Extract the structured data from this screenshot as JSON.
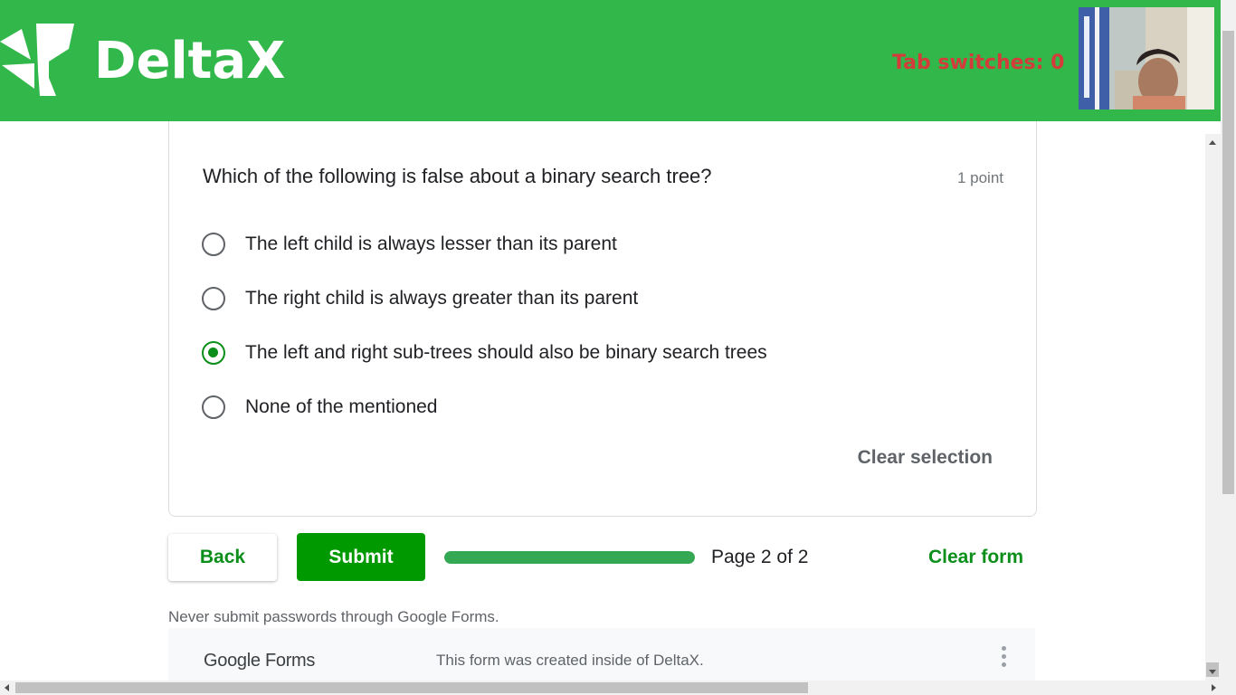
{
  "header": {
    "brand": "DeltaX",
    "tab_switches": "Tab switches: 0"
  },
  "question": {
    "text": "Which of the following is false about a binary search tree?",
    "points": "1 point",
    "options": [
      {
        "label": "The left child is always lesser than its parent",
        "selected": false
      },
      {
        "label": "The right child is always greater than its parent",
        "selected": false
      },
      {
        "label": "The left and right sub-trees should also be binary search trees",
        "selected": true
      },
      {
        "label": "None of the mentioned",
        "selected": false
      }
    ],
    "clear_selection": "Clear selection"
  },
  "navigation": {
    "back_label": "Back",
    "submit_label": "Submit",
    "progress_percent": 100,
    "page_indicator": "Page 2 of 2",
    "clear_form_label": "Clear form"
  },
  "footer": {
    "disclaimer": "Never submit passwords through Google Forms.",
    "google_forms": "Google Forms",
    "note": "This form was created inside of DeltaX."
  },
  "colors": {
    "header_bg": "#31b74a",
    "accent": "#0b8f1a",
    "submit_bg": "#009a00",
    "tab_switch_text": "#d43c3c",
    "progress_fill": "#34a853"
  },
  "icons": {
    "logo": "deltax-logo-icon",
    "more": "more-vert-icon"
  }
}
